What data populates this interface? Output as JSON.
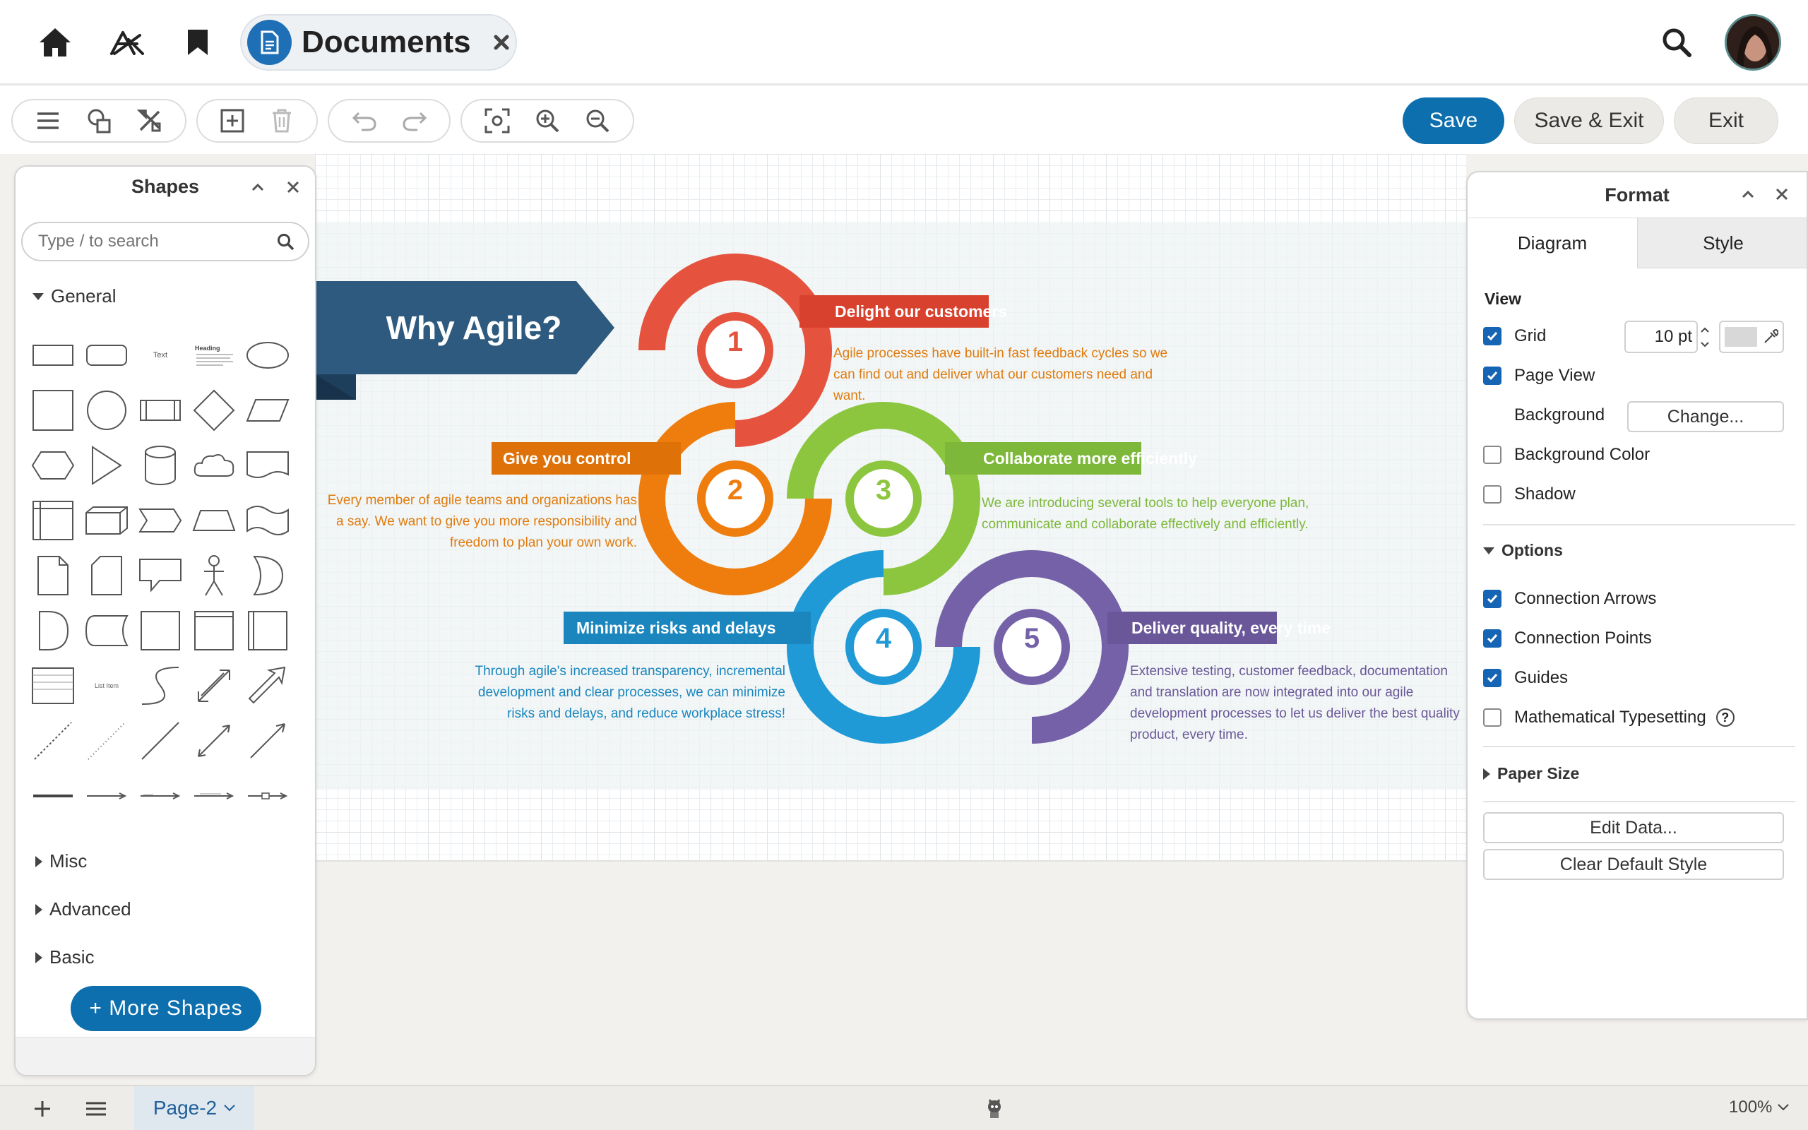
{
  "header": {
    "doc_title": "Documents"
  },
  "toolbar": {
    "save_label": "Save",
    "save_exit_label": "Save & Exit",
    "exit_label": "Exit"
  },
  "shapes_panel": {
    "title": "Shapes",
    "search_placeholder": "Type / to search",
    "sections": [
      "General",
      "Misc",
      "Advanced",
      "Basic"
    ],
    "more_shapes_label": "+ More Shapes",
    "sample_text": "Text",
    "sample_heading": "Heading",
    "sample_list_item": "List Item"
  },
  "diagram": {
    "title": "Why Agile?",
    "colors": {
      "red": "#e5533f",
      "orange": "#ef7d0d",
      "green": "#8cc63f",
      "blue": "#1f9ad6",
      "purple": "#7461a8",
      "navy": "#2d5a7e"
    },
    "steps": [
      {
        "number": "1",
        "heading": "Delight our customers",
        "text": "Agile processes have built-in fast feedback cycles so we can find out and deliver what our customers need and want."
      },
      {
        "number": "2",
        "heading": "Give you control",
        "text": "Every member of agile teams and organizations has a say. We want to give you more responsibility and freedom to plan your own work."
      },
      {
        "number": "3",
        "heading": "Collaborate more efficiently",
        "text": "We are introducing several tools to help everyone plan, communicate and collaborate effectively and efficiently."
      },
      {
        "number": "4",
        "heading": "Minimize risks and delays",
        "text": "Through agile's increased transparency, incremental development and clear processes, we can minimize risks and delays, and reduce workplace stress!"
      },
      {
        "number": "5",
        "heading": "Deliver quality, every time",
        "text": "Extensive testing, customer feedback, documentation and translation are now integrated into our agile development processes to let us deliver the best quality product, every time."
      }
    ]
  },
  "format_panel": {
    "title": "Format",
    "tabs": [
      "Diagram",
      "Style"
    ],
    "view_label": "View",
    "grid_label": "Grid",
    "grid_size": "10 pt",
    "page_view_label": "Page View",
    "background_label": "Background",
    "change_label": "Change...",
    "background_color_label": "Background Color",
    "shadow_label": "Shadow",
    "options_label": "Options",
    "connection_arrows_label": "Connection Arrows",
    "connection_points_label": "Connection Points",
    "guides_label": "Guides",
    "math_label": "Mathematical Typesetting",
    "paper_size_label": "Paper Size",
    "edit_data_label": "Edit Data...",
    "clear_style_label": "Clear Default Style",
    "checkboxes": {
      "grid": true,
      "page_view": true,
      "background_color": false,
      "shadow": false,
      "connection_arrows": true,
      "connection_points": true,
      "guides": true,
      "math": false
    }
  },
  "footer": {
    "page_tab": "Page-2",
    "zoom": "100%"
  }
}
